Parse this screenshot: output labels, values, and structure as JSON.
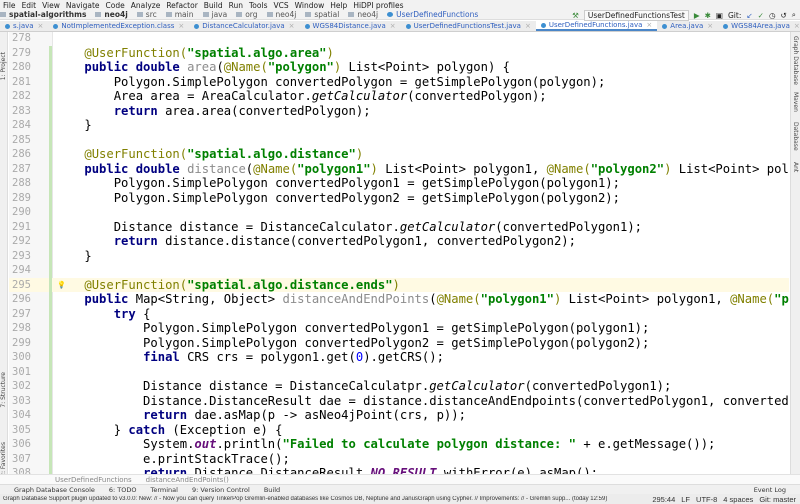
{
  "menu": [
    "File",
    "Edit",
    "View",
    "Navigate",
    "Code",
    "Analyze",
    "Refactor",
    "Build",
    "Run",
    "Tools",
    "VCS",
    "Window",
    "Help",
    "HiDPI profiles"
  ],
  "breadcrumb": [
    "spatial-algorithms",
    "neo4j",
    "src",
    "main",
    "java",
    "org",
    "neo4j",
    "spatial",
    "neo4j",
    "UserDefinedFunctions"
  ],
  "run_config": {
    "selected": "UserDefinedFunctionsTest",
    "git_label": "Git:"
  },
  "tabs": [
    {
      "label": "s.java",
      "active": false
    },
    {
      "label": "NotImplementedException.class",
      "active": false
    },
    {
      "label": "DistanceCalculator.java",
      "active": false
    },
    {
      "label": "WGS84Distance.java",
      "active": false
    },
    {
      "label": "UserDefinedFunctionsTest.java",
      "active": false
    },
    {
      "label": "UserDefinedFunctions.java",
      "active": true
    },
    {
      "label": "Area.java",
      "active": false
    },
    {
      "label": "WGS84Area.java",
      "active": false
    },
    {
      "label": "CartesianArea.java",
      "active": false
    },
    {
      "label": "CartesianCCW.java",
      "active": false
    }
  ],
  "left_tools": [
    "1: Project",
    "7: Structure",
    "2: Favorites"
  ],
  "right_tools": [
    "Graph Database",
    "Maven",
    "Database",
    "Ant"
  ],
  "editor": {
    "current_line": 295,
    "lines": [
      {
        "n": 278,
        "t": []
      },
      {
        "n": 279,
        "t": [
          [
            "    "
          ],
          [
            "@UserFunction(",
            "a"
          ],
          [
            "\"spatial.algo.area\"",
            "s"
          ],
          [
            ")",
            "a"
          ]
        ]
      },
      {
        "n": 280,
        "t": [
          [
            "    "
          ],
          [
            "public double ",
            "k"
          ],
          [
            "area",
            "m"
          ],
          [
            "("
          ],
          [
            "@Name(",
            "a"
          ],
          [
            "\"polygon\"",
            "s"
          ],
          [
            ")",
            "a"
          ],
          [
            " List<Point> polygon) {"
          ]
        ]
      },
      {
        "n": 281,
        "t": [
          [
            "        Polygon.SimplePolygon convertedPolygon = getSimplePolygon(polygon);"
          ]
        ]
      },
      {
        "n": 282,
        "t": [
          [
            "        Area area = AreaCalculator."
          ],
          [
            "getCalculator",
            "i"
          ],
          [
            "(convertedPolygon);"
          ]
        ]
      },
      {
        "n": 283,
        "t": [
          [
            "        "
          ],
          [
            "return ",
            "k"
          ],
          [
            "area.area(convertedPolygon);"
          ]
        ]
      },
      {
        "n": 284,
        "t": [
          [
            "    }"
          ]
        ]
      },
      {
        "n": 285,
        "t": []
      },
      {
        "n": 286,
        "t": [
          [
            "    "
          ],
          [
            "@UserFunction(",
            "a"
          ],
          [
            "\"spatial.algo.distance\"",
            "s"
          ],
          [
            ")",
            "a"
          ]
        ]
      },
      {
        "n": 287,
        "t": [
          [
            "    "
          ],
          [
            "public double ",
            "k"
          ],
          [
            "distance",
            "m"
          ],
          [
            "("
          ],
          [
            "@Name(",
            "a"
          ],
          [
            "\"polygon1\"",
            "s"
          ],
          [
            ")",
            "a"
          ],
          [
            " List<Point> polygon1, "
          ],
          [
            "@Name(",
            "a"
          ],
          [
            "\"polygon2\"",
            "s"
          ],
          [
            ")",
            "a"
          ],
          [
            " List<Point> polygon2) {"
          ]
        ]
      },
      {
        "n": 288,
        "t": [
          [
            "        Polygon.SimplePolygon convertedPolygon1 = getSimplePolygon(polygon1);"
          ]
        ]
      },
      {
        "n": 289,
        "t": [
          [
            "        Polygon.SimplePolygon convertedPolygon2 = getSimplePolygon(polygon2);"
          ]
        ]
      },
      {
        "n": 290,
        "t": []
      },
      {
        "n": 291,
        "t": [
          [
            "        Distance distance = DistanceCalculator."
          ],
          [
            "getCalculator",
            "i"
          ],
          [
            "(convertedPolygon1);"
          ]
        ]
      },
      {
        "n": 292,
        "t": [
          [
            "        "
          ],
          [
            "return ",
            "k"
          ],
          [
            "distance.distance(convertedPolygon1, convertedPolygon2);"
          ]
        ]
      },
      {
        "n": 293,
        "t": [
          [
            "    }"
          ]
        ]
      },
      {
        "n": 294,
        "t": []
      },
      {
        "n": 295,
        "t": [
          [
            "    "
          ],
          [
            "@UserFunction(",
            "a"
          ],
          [
            "\"spatial.algo.distance.ends\"",
            "s"
          ],
          [
            ")",
            "a"
          ]
        ]
      },
      {
        "n": 296,
        "t": [
          [
            "    "
          ],
          [
            "public ",
            "k"
          ],
          [
            "Map<String, Object> "
          ],
          [
            "distanceAndEndPoints",
            "m"
          ],
          [
            "("
          ],
          [
            "@Name(",
            "a"
          ],
          [
            "\"polygon1\"",
            "s"
          ],
          [
            ")",
            "a"
          ],
          [
            " List<Point> polygon1, "
          ],
          [
            "@Name(",
            "a"
          ],
          [
            "\"polygon2\"",
            "s"
          ],
          [
            ")",
            "a"
          ],
          [
            " List<Point> polyg"
          ]
        ]
      },
      {
        "n": 297,
        "t": [
          [
            "        "
          ],
          [
            "try ",
            "k"
          ],
          [
            "{"
          ]
        ]
      },
      {
        "n": 298,
        "t": [
          [
            "            Polygon.SimplePolygon convertedPolygon1 = getSimplePolygon(polygon1);"
          ]
        ]
      },
      {
        "n": 299,
        "t": [
          [
            "            Polygon.SimplePolygon convertedPolygon2 = getSimplePolygon(polygon2);"
          ]
        ]
      },
      {
        "n": 300,
        "t": [
          [
            "            "
          ],
          [
            "final ",
            "k"
          ],
          [
            "CRS crs = polygon1.get("
          ],
          [
            "0",
            "n"
          ],
          [
            ").getCRS();"
          ]
        ]
      },
      {
        "n": 301,
        "t": []
      },
      {
        "n": 302,
        "t": [
          [
            "            Distance distance = DistanceCalculatpr."
          ],
          [
            "getCalculator",
            "i"
          ],
          [
            "(convertedPolygon1);"
          ]
        ]
      },
      {
        "n": 303,
        "t": [
          [
            "            Distance.DistanceResult dae = distance.distanceAndEndpoints(convertedPolygon1, convertedPolygon2);"
          ]
        ]
      },
      {
        "n": 304,
        "t": [
          [
            "            "
          ],
          [
            "return ",
            "k"
          ],
          [
            "dae.asMap(p -> asNeo4jPoint(crs, p));"
          ]
        ]
      },
      {
        "n": 305,
        "t": [
          [
            "        } "
          ],
          [
            "catch ",
            "k"
          ],
          [
            "(Exception e) {"
          ]
        ]
      },
      {
        "n": 306,
        "t": [
          [
            "            System."
          ],
          [
            "out",
            "f"
          ],
          [
            ".println("
          ],
          [
            "\"Failed to calculate polygon distance: \"",
            "s"
          ],
          [
            " + e.getMessage());"
          ]
        ]
      },
      {
        "n": 307,
        "t": [
          [
            "            e.printStackTrace();"
          ]
        ]
      },
      {
        "n": 308,
        "t": [
          [
            "            "
          ],
          [
            "return ",
            "k"
          ],
          [
            "Distance.DistanceResult."
          ],
          [
            "NO_RESULT",
            "f"
          ],
          [
            ".withError(e).asMap();"
          ]
        ]
      }
    ]
  },
  "editor_breadcrumb": [
    "UserDefinedFunctions",
    "distanceAndEndPoints()"
  ],
  "tool_windows": [
    "Graph Database Console",
    "6: TODO",
    "Terminal",
    "9: Version Control",
    "Build"
  ],
  "event_log": "Event Log",
  "status": {
    "message": "Graph Database Support plugin updated to v3.0.0: New: // - Now you can query TinkerPop Gremlin-enabled databases like Cosmos DB, Neptune and JanusGraph using Cypher. // Improvements: // - Gremlin supp... (today 12:59)",
    "position": "295:44",
    "line_sep": "LF",
    "encoding": "UTF-8",
    "indent": "4 spaces",
    "git": "Git: master"
  }
}
